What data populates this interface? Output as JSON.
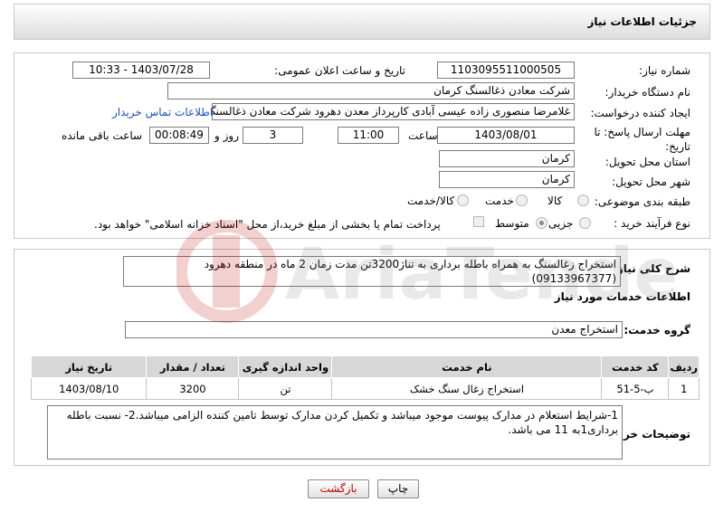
{
  "title": "جزئیات اطلاعات نیاز",
  "form": {
    "need_number_label": "شماره نیاز:",
    "need_number": "1103095511000505",
    "announce_label": "تاریخ و ساعت اعلان عمومی:",
    "announce_value": "1403/07/28 - 10:33",
    "buyer_org_label": "نام دستگاه خریدار:",
    "buyer_org": "شرکت معادن ذغالسنگ کرمان",
    "creator_label": "ایجاد کننده درخواست:",
    "creator": "غلامرضا منصوری زاده عیسی آبادی کارپرداز معدن دهرود شرکت معادن ذغالسنگ",
    "contact_link": "اطلاعات تماس خریدار",
    "deadline_label": "مهلت ارسال پاسخ: تا تاریخ:",
    "deadline_date": "1403/08/01",
    "time_label": "ساعت",
    "deadline_time": "11:00",
    "days_value": "3",
    "days_label": "روز و",
    "remaining_value": "00:08:49",
    "remaining_label": "ساعت باقی مانده",
    "province_label": "استان محل تحویل:",
    "province": "کرمان",
    "city_label": "شهر محل تحویل:",
    "city": "کرمان",
    "category_label": "طبقه بندی موضوعی:",
    "category_options": [
      "کالا",
      "خدمت",
      "کالا/خدمت"
    ],
    "process_label": "نوع فرآیند خرید :",
    "process_options": [
      "جزیی",
      "متوسط"
    ],
    "payment_note": "پرداخت تمام یا بخشی از مبلغ خرید،از محل \"اسناد خزانه اسلامی\" خواهد بود."
  },
  "description": {
    "label": "شرح کلی نیاز:",
    "text": "استخراج زغالسنگ به همراه باطله برداری به تناژ3200تن مدت زمان 2 ماه در منطقه دهرود (09133967377)"
  },
  "services": {
    "heading": "اطلاعات خدمات مورد نیاز",
    "group_label": "گروه خدمت:",
    "group_value": "استخراج معدن",
    "columns": [
      "ردیف",
      "کد خدمت",
      "نام خدمت",
      "واحد اندازه گیری",
      "تعداد / مقدار",
      "تاریخ نیاز"
    ],
    "rows": [
      [
        "1",
        "ب-5-51",
        "استخراج زغال سنگ خشک",
        "تن",
        "3200",
        "1403/08/10"
      ]
    ]
  },
  "buyer_notes": {
    "label": "توضیحات خریدار:",
    "text": "1-شرایط استعلام در مدارک پیوست موجود میباشد و تکمیل کردن مدارک توسط تامین کننده الزامی میباشد.2- نسبت باطله برداری1به 11 می باشد."
  },
  "buttons": {
    "print": "چاپ",
    "back": "بازگشت"
  },
  "watermark": "AriaTender.neT",
  "colors": {
    "link": "#1a52b3",
    "back_button_text": "#c00000",
    "table_header": "#d7d7d7"
  }
}
